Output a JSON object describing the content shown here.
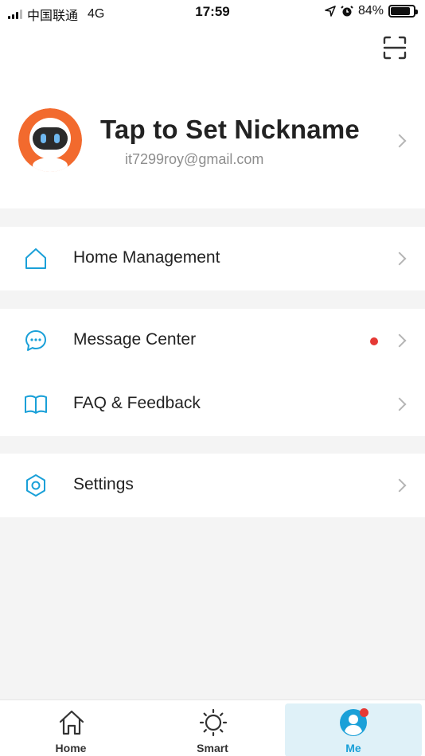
{
  "status_bar": {
    "carrier": "中国联通",
    "network": "4G",
    "time": "17:59",
    "battery_percent": "84%",
    "battery_level": 0.84
  },
  "profile": {
    "nickname": "Tap to Set Nickname",
    "email": "it7299roy@gmail.com"
  },
  "menu": {
    "home_management": "Home Management",
    "message_center": "Message Center",
    "faq_feedback": "FAQ & Feedback",
    "settings": "Settings"
  },
  "tabs": [
    {
      "label": "Home",
      "icon": "home-icon",
      "active": false
    },
    {
      "label": "Smart",
      "icon": "sun-icon",
      "active": false
    },
    {
      "label": "Me",
      "icon": "user-icon",
      "active": true
    }
  ],
  "colors": {
    "accent": "#1aa0d8",
    "notification": "#e53935",
    "avatar_orange": "#f26a2e"
  }
}
